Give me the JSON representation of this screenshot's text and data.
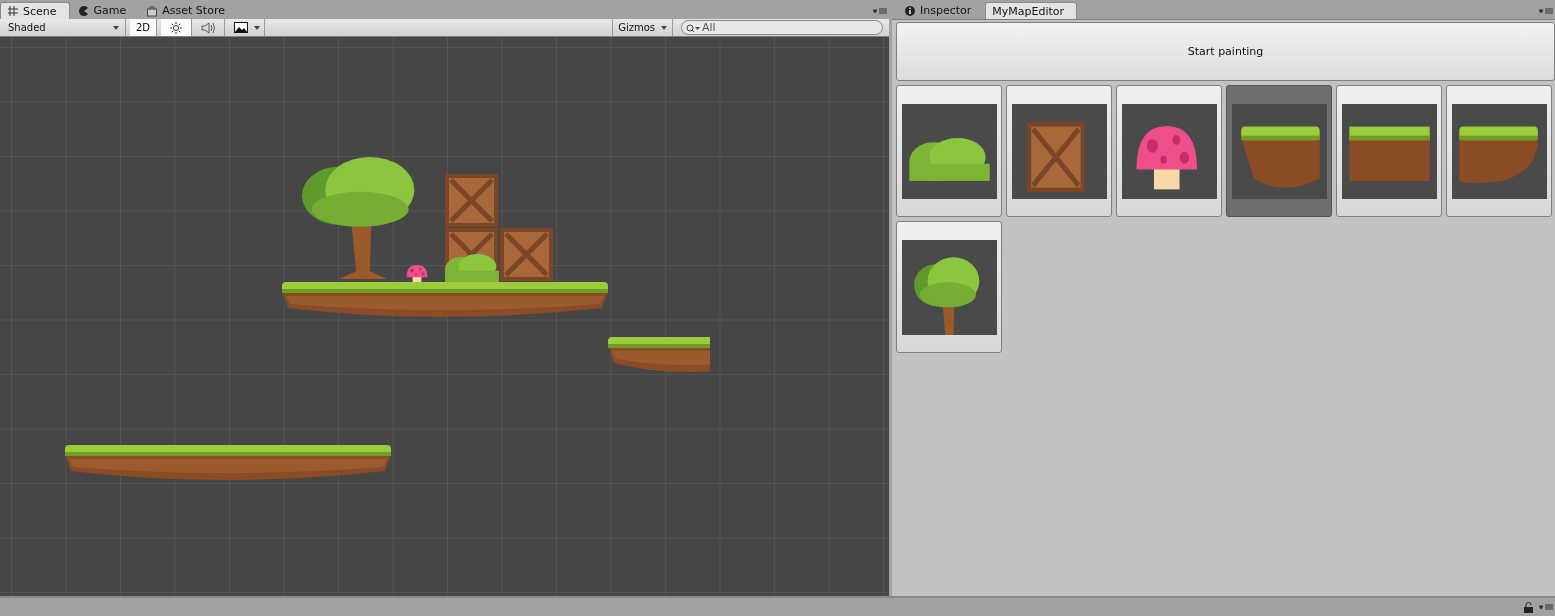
{
  "scene_panel": {
    "tabs": [
      {
        "label": "Scene",
        "kind": "scene",
        "selected": true
      },
      {
        "label": "Game",
        "kind": "game",
        "selected": false
      },
      {
        "label": "Asset Store",
        "kind": "store",
        "selected": false
      }
    ],
    "toolbar": {
      "shading_mode": "Shaded",
      "mode_2d": {
        "label": "2D",
        "on": true
      },
      "lighting_on": true,
      "audio_on": false,
      "gizmos": "Gizmos",
      "search": {
        "placeholder": "All"
      }
    }
  },
  "editor_panel": {
    "tabs": [
      {
        "label": "Inspector",
        "kind": "inspector",
        "selected": false
      },
      {
        "label": "MyMapEditor",
        "kind": "editor",
        "selected": true
      }
    ],
    "start_button": "Start painting",
    "palette": [
      {
        "kind": "bush",
        "selected": false
      },
      {
        "kind": "crate",
        "selected": false
      },
      {
        "kind": "mushroom",
        "selected": false
      },
      {
        "kind": "ground-left",
        "selected": true
      },
      {
        "kind": "ground-middle",
        "selected": false
      },
      {
        "kind": "ground-right",
        "selected": false
      },
      {
        "kind": "tree",
        "selected": false
      }
    ]
  }
}
